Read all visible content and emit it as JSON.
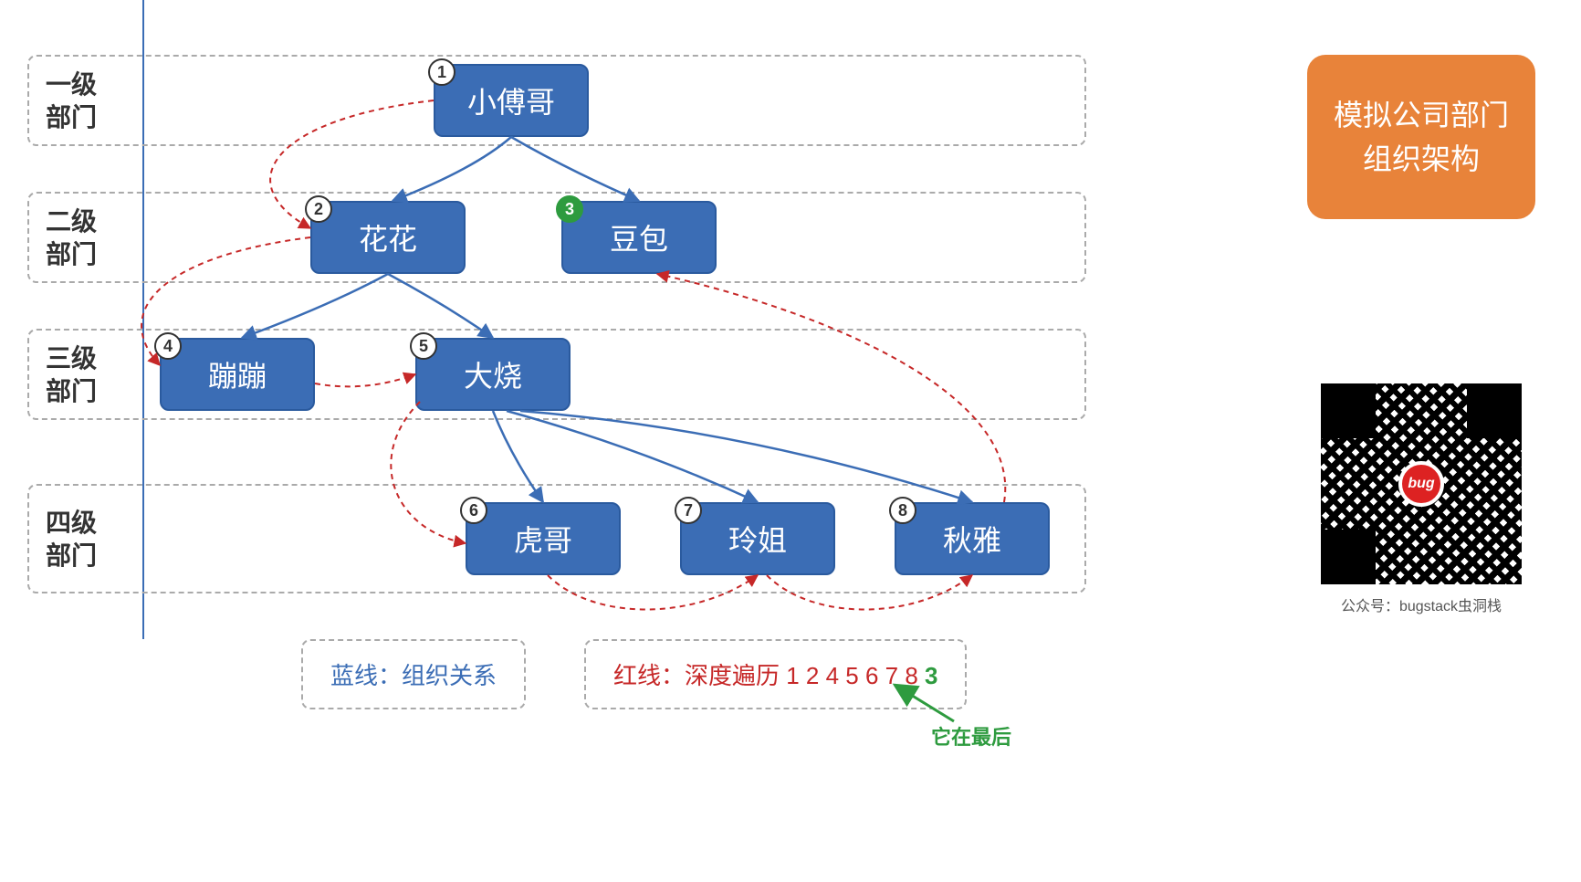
{
  "levels": [
    {
      "label": "一级\n部门"
    },
    {
      "label": "二级\n部门"
    },
    {
      "label": "三级\n部门"
    },
    {
      "label": "四级\n部门"
    }
  ],
  "nodes": {
    "n1": {
      "num": "1",
      "name": "小傅哥",
      "highlight": false
    },
    "n2": {
      "num": "2",
      "name": "花花",
      "highlight": false
    },
    "n3": {
      "num": "3",
      "name": "豆包",
      "highlight": true
    },
    "n4": {
      "num": "4",
      "name": "蹦蹦",
      "highlight": false
    },
    "n5": {
      "num": "5",
      "name": "大烧",
      "highlight": false
    },
    "n6": {
      "num": "6",
      "name": "虎哥",
      "highlight": false
    },
    "n7": {
      "num": "7",
      "name": "玲姐",
      "highlight": false
    },
    "n8": {
      "num": "8",
      "name": "秋雅",
      "highlight": false
    }
  },
  "orange_box": "模拟公司部门组织架构",
  "qr_center": "bug",
  "qr_caption": "公众号：bugstack虫洞栈",
  "legend_blue": "蓝线：组织关系",
  "legend_red_prefix": "红线：深度遍历 1 2 4 5 6 7 8 ",
  "legend_red_highlight": "3",
  "annotation": "它在最后",
  "tree_edges_blue": [
    [
      "n1",
      "n2"
    ],
    [
      "n1",
      "n3"
    ],
    [
      "n2",
      "n4"
    ],
    [
      "n2",
      "n5"
    ],
    [
      "n5",
      "n6"
    ],
    [
      "n5",
      "n7"
    ],
    [
      "n5",
      "n8"
    ]
  ],
  "traversal_edges_red": [
    [
      "n1",
      "n2"
    ],
    [
      "n2",
      "n4"
    ],
    [
      "n4",
      "n5"
    ],
    [
      "n5",
      "n6"
    ],
    [
      "n6",
      "n7"
    ],
    [
      "n7",
      "n8"
    ],
    [
      "n8",
      "n3"
    ]
  ]
}
